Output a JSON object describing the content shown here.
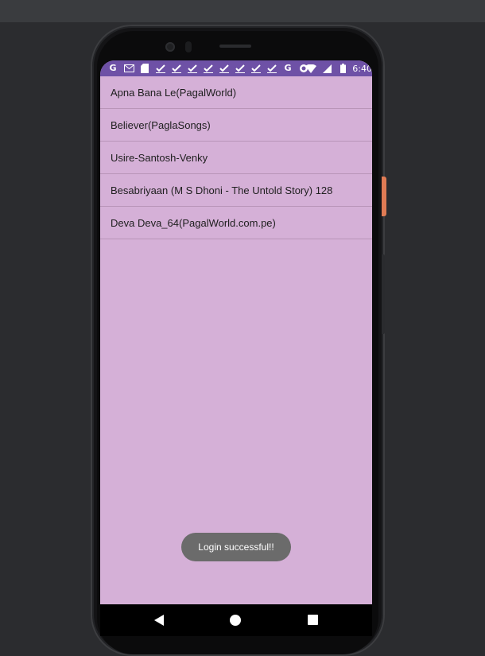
{
  "status_bar": {
    "time": "6:40",
    "icons": [
      "google-icon",
      "gmail-icon",
      "sd-card-icon",
      "check-icon",
      "check-icon",
      "check-icon",
      "check-icon",
      "check-icon",
      "check-icon",
      "check-icon",
      "check-icon",
      "google-icon",
      "circle-icon",
      "wifi-icon",
      "signal-icon",
      "battery-icon"
    ],
    "accent_color": "#6e51a6"
  },
  "songs": [
    "Apna Bana Le(PagalWorld)",
    "Believer(PaglaSongs)",
    "Usire-Santosh-Venky",
    "Besabriyaan (M S Dhoni - The Untold Story) 128",
    "Deva Deva_64(PagalWorld.com.pe)"
  ],
  "toast": {
    "message": "Login successful!!"
  },
  "nav": {
    "back": "back-icon",
    "home": "home-icon",
    "recents": "recents-icon"
  },
  "colors": {
    "list_background": "#d5b0d7",
    "divider": "#b995b8"
  }
}
